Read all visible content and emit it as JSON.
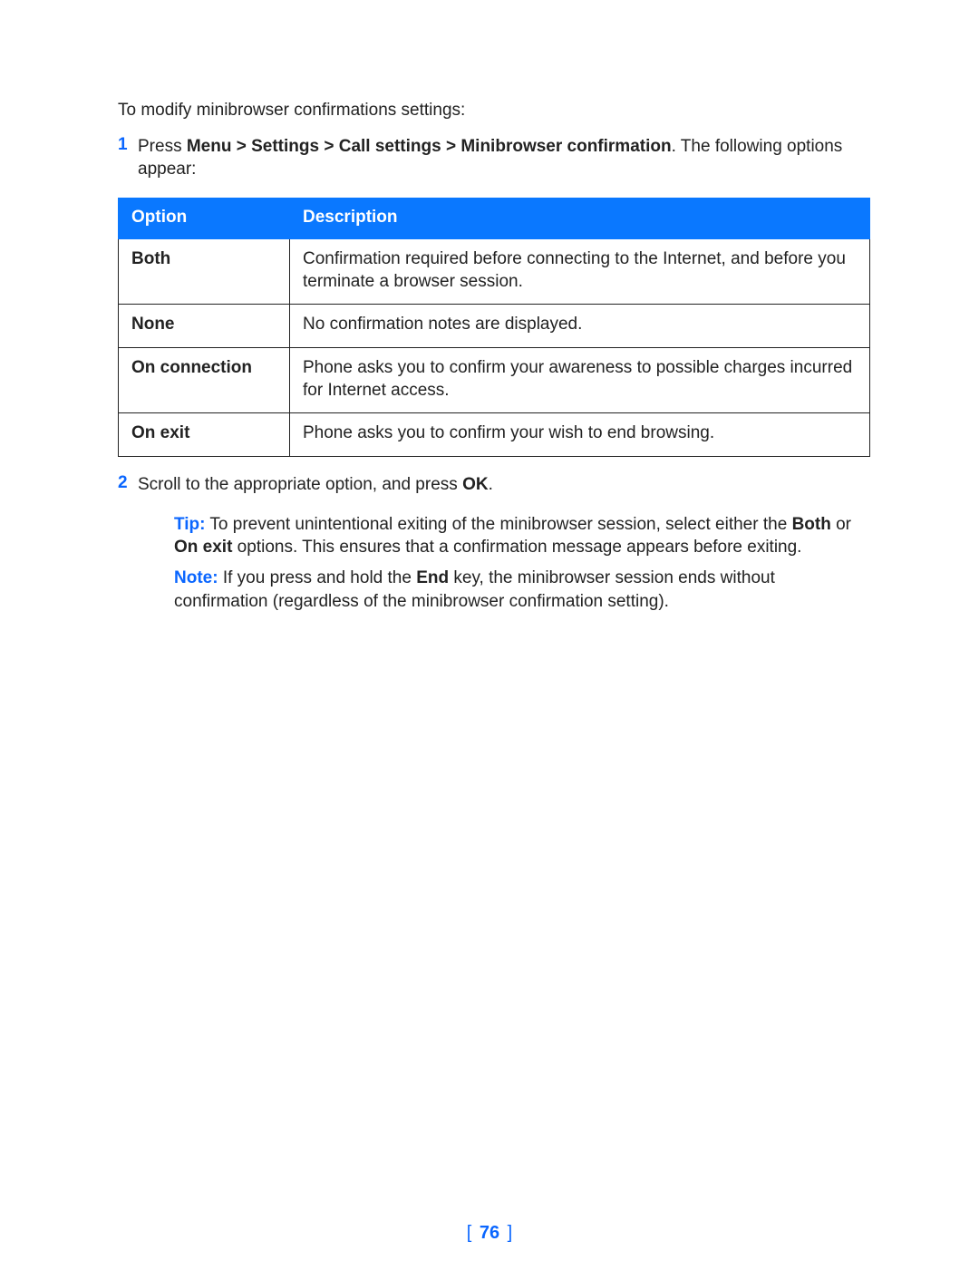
{
  "intro": "To modify minibrowser confirmations settings:",
  "step1": {
    "number": "1",
    "prefix": "Press ",
    "path": "Menu > Settings > Call settings > Minibrowser confirmation",
    "suffix": ". The following options appear:"
  },
  "table": {
    "headers": {
      "option": "Option",
      "description": "Description"
    },
    "rows": [
      {
        "option": "Both",
        "description": "Confirmation required before connecting to the Internet, and before you terminate a browser session."
      },
      {
        "option": "None",
        "description": "No confirmation notes are displayed."
      },
      {
        "option": "On connection",
        "description": "Phone asks you to confirm your awareness to possible charges incurred for Internet access."
      },
      {
        "option": "On exit",
        "description": "Phone asks you to confirm your wish to end browsing."
      }
    ]
  },
  "step2": {
    "number": "2",
    "text_a": "Scroll to the appropriate option, and press ",
    "text_b": "OK",
    "text_c": "."
  },
  "tip": {
    "label": "Tip:",
    "a": " To prevent unintentional exiting of the minibrowser session, select either the ",
    "b1": "Both",
    "b": " or ",
    "b2": "On exit",
    "c": " options. This ensures that a confirmation message appears before exiting."
  },
  "note": {
    "label": "Note:",
    "a": " If you press and hold the ",
    "key": "End",
    "b": " key, the minibrowser session ends without confirmation (regardless of the minibrowser confirmation setting)."
  },
  "footer": {
    "lb": "[ ",
    "page": "76",
    "rb": " ]"
  }
}
